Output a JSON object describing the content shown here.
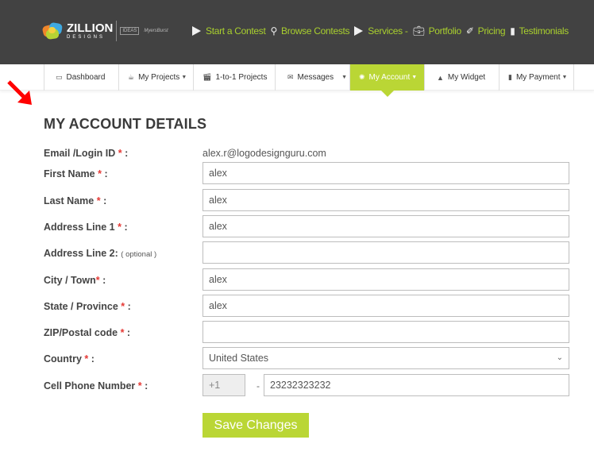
{
  "brand": {
    "name": "ZILLION",
    "sub": "DESIGNS",
    "badge1": "IDEAS",
    "badge2": "MyersBurst"
  },
  "topnav": [
    {
      "label": "Start a Contest",
      "icon": "play-icon"
    },
    {
      "label": "Browse Contests",
      "icon": "search-icon"
    },
    {
      "label": "Services -",
      "icon": "play-icon"
    },
    {
      "label": "Portfolio",
      "icon": "briefcase-icon"
    },
    {
      "label": "Pricing",
      "icon": "tag-icon"
    },
    {
      "label": "Testimonials",
      "icon": "comment-icon"
    }
  ],
  "subnav": [
    {
      "label": "Dashboard",
      "icon": "monitor-icon",
      "caret": false,
      "active": false
    },
    {
      "label": "My Projects",
      "icon": "coffee-icon",
      "caret": true,
      "active": false
    },
    {
      "label": "1-to-1 Projects",
      "icon": "clapper-icon",
      "caret": false,
      "active": false
    },
    {
      "label": "Messages",
      "icon": "envelope-icon",
      "caret": true,
      "active": false
    },
    {
      "label": "My Account",
      "icon": "gear-icon",
      "caret": true,
      "active": true
    },
    {
      "label": "My Widget",
      "icon": "user-icon",
      "caret": false,
      "active": false
    },
    {
      "label": "My Payment",
      "icon": "briefcase-icon",
      "caret": true,
      "active": false
    }
  ],
  "page": {
    "title": "MY ACCOUNT DETAILS"
  },
  "form": {
    "email": {
      "label": "Email /Login ID",
      "req": "*",
      "colon": " :",
      "value": "alex.r@logodesignguru.com"
    },
    "first_name": {
      "label": "First Name",
      "req": "*",
      "colon": " :",
      "value": "alex"
    },
    "last_name": {
      "label": "Last Name",
      "req": "*",
      "colon": " :",
      "value": "alex"
    },
    "address1": {
      "label": "Address Line 1",
      "req": "*",
      "colon": " :",
      "value": "alex"
    },
    "address2": {
      "label": "Address Line 2:",
      "optional": "( optional )",
      "value": ""
    },
    "city": {
      "label": "City / Town",
      "req": "*",
      "colon": " :",
      "value": "alex"
    },
    "state": {
      "label": "State / Province",
      "req": "*",
      "colon": " :",
      "value": "alex"
    },
    "zip": {
      "label": "ZIP/Postal code",
      "req": "*",
      "colon": " :",
      "value": ""
    },
    "country": {
      "label": "Country",
      "req": "*",
      "colon": " :",
      "value": "United States"
    },
    "phone": {
      "label": "Cell Phone Number",
      "req": "*",
      "colon": " :",
      "country_code": "+1",
      "separator": "-",
      "value": "23232323232"
    }
  },
  "actions": {
    "save_label": "Save Changes"
  },
  "colors": {
    "accent": "#bad635",
    "topbar": "#424242",
    "required": "#e53935",
    "annotation_arrow": "#ff0000"
  }
}
